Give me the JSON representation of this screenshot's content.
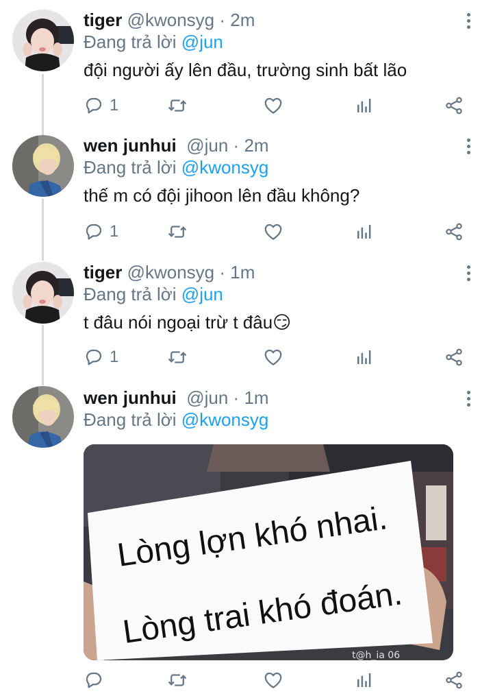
{
  "reply_prefix": "Đang trả lời",
  "tweets": [
    {
      "name": "tiger",
      "handle": "@kwonsyg",
      "dot": "·",
      "time": "2m",
      "reply_to": "@jun",
      "text": "đội người ấy lên đầu, trường sinh bất lão",
      "reply_count": "1"
    },
    {
      "name": "wen junhui",
      "handle": "@jun",
      "dot": "·",
      "time": "2m",
      "reply_to": "@kwonsyg",
      "text": "thế m có đội jihoon lên đầu không?",
      "reply_count": "1"
    },
    {
      "name": "tiger",
      "handle": "@kwonsyg",
      "dot": "·",
      "time": "1m",
      "reply_to": "@jun",
      "text": "t đâu nói ngoại trừ t đâu😏",
      "reply_count": "1"
    },
    {
      "name": "wen junhui",
      "handle": "@jun",
      "dot": "·",
      "time": "1m",
      "reply_to": "@kwonsyg",
      "reply_count": ""
    }
  ],
  "media": {
    "sign_line1": "Lòng lợn khó nhai.",
    "sign_line2": "Lòng trai khó đoán.",
    "watermark": "t@h_ia 06"
  },
  "icons": {
    "reply": "reply-icon",
    "retweet": "retweet-icon",
    "like": "heart-icon",
    "analytics": "analytics-icon",
    "share": "share-icon",
    "more": "more-icon"
  },
  "colors": {
    "mention": "#1da1f2",
    "secondary": "#657786",
    "thread_line": "#cfd9de"
  }
}
